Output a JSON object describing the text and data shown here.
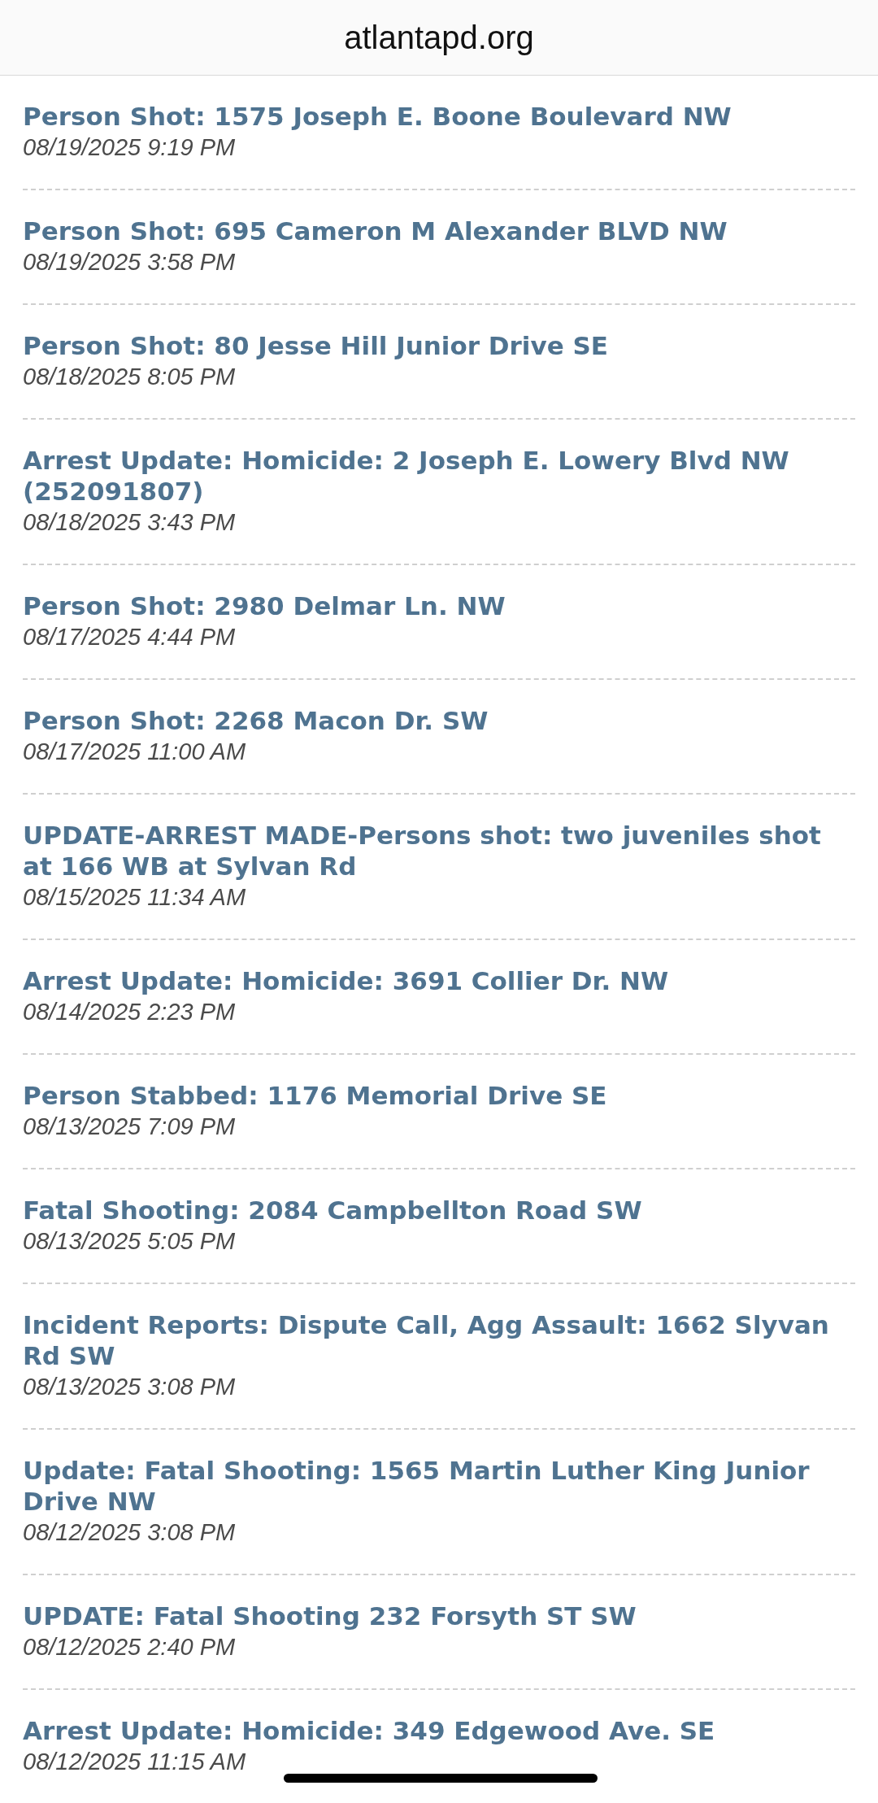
{
  "header": {
    "title": "atlantapd.org"
  },
  "items": [
    {
      "title": "Person Shot: 1575 Joseph E. Boone Boulevard NW",
      "date": "08/19/2025 9:19 PM"
    },
    {
      "title": "Person Shot: 695 Cameron M Alexander BLVD NW",
      "date": "08/19/2025 3:58 PM"
    },
    {
      "title": "Person Shot: 80 Jesse Hill Junior Drive SE",
      "date": "08/18/2025 8:05 PM"
    },
    {
      "title": "Arrest Update: Homicide: 2 Joseph E. Lowery Blvd NW (252091807)",
      "date": "08/18/2025 3:43 PM"
    },
    {
      "title": "Person Shot: 2980 Delmar Ln. NW",
      "date": "08/17/2025 4:44 PM"
    },
    {
      "title": "Person Shot: 2268 Macon Dr. SW",
      "date": "08/17/2025 11:00 AM"
    },
    {
      "title": "UPDATE-ARREST MADE-Persons shot: two juveniles shot at 166 WB at Sylvan Rd",
      "date": "08/15/2025 11:34 AM"
    },
    {
      "title": "Arrest Update: Homicide: 3691 Collier Dr. NW",
      "date": "08/14/2025 2:23 PM"
    },
    {
      "title": "Person Stabbed: 1176 Memorial Drive SE",
      "date": "08/13/2025 7:09 PM"
    },
    {
      "title": "Fatal Shooting: 2084 Campbellton Road SW",
      "date": "08/13/2025 5:05 PM"
    },
    {
      "title": "Incident Reports: Dispute Call, Agg Assault: 1662 Slyvan Rd SW",
      "date": "08/13/2025 3:08 PM"
    },
    {
      "title": "Update: Fatal Shooting: 1565 Martin Luther King Junior Drive NW",
      "date": "08/12/2025 3:08 PM"
    },
    {
      "title": "UPDATE: Fatal Shooting 232 Forsyth ST SW",
      "date": "08/12/2025 2:40 PM"
    },
    {
      "title": "Arrest Update: Homicide: 349 Edgewood Ave. SE",
      "date": "08/12/2025 11:15 AM"
    }
  ]
}
